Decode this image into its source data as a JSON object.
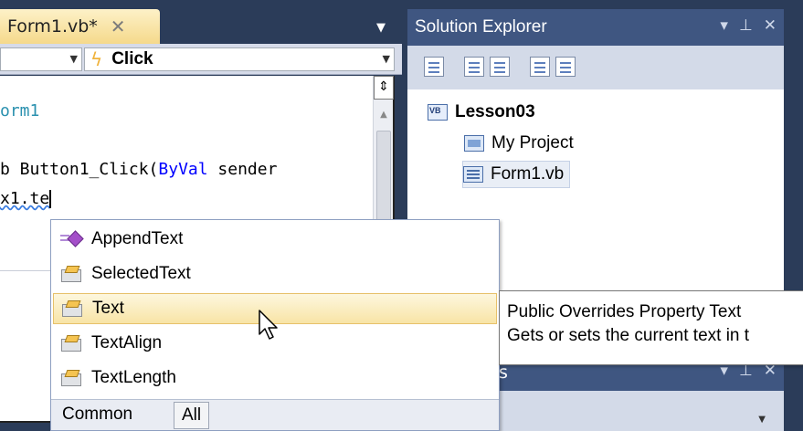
{
  "editor": {
    "tab_title": "Form1.vb*",
    "tab_close": "✕",
    "nav_event": "Click",
    "code_lines": [
      "orm1",
      "b Button1_Click(",
      "ByVal",
      " sender",
      "x1.te"
    ]
  },
  "solution_explorer": {
    "title": "Solution Explorer",
    "items": [
      "Lesson03",
      "My Project",
      "Form1.vb"
    ]
  },
  "properties": {
    "title_fragment": "s"
  },
  "intellisense": {
    "items": [
      {
        "label": "AppendText",
        "kind": "method"
      },
      {
        "label": "SelectedText",
        "kind": "property"
      },
      {
        "label": "Text",
        "kind": "property",
        "selected": true
      },
      {
        "label": "TextAlign",
        "kind": "property"
      },
      {
        "label": "TextLength",
        "kind": "property"
      }
    ],
    "tabs": [
      "Common",
      "All"
    ]
  },
  "tooltip": {
    "line1": "Public Overrides Property Text",
    "line2": "Gets or sets the current text in t"
  },
  "colors": {
    "accent": "#3f5681",
    "selection": "#f8e4a6",
    "keyword": "#0000ff"
  }
}
